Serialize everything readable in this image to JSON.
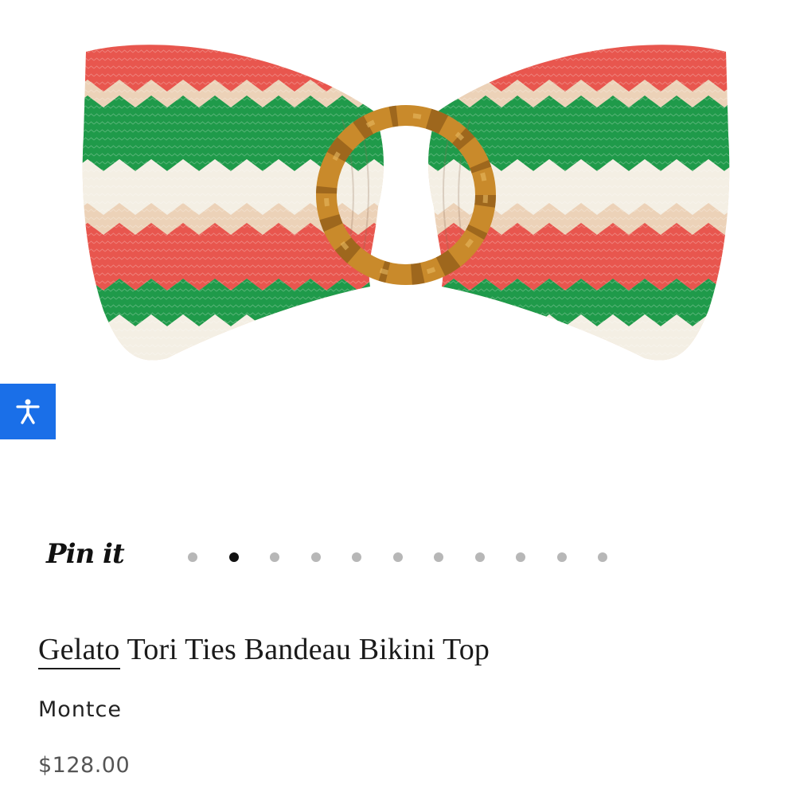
{
  "product": {
    "image_alt": "Gelato Tori Ties Bandeau Bikini Top",
    "title_brand": "Gelato",
    "title_rest": " Tori Ties Bandeau Bikini Top",
    "vendor": "Montce",
    "price": "$128.00"
  },
  "share": {
    "pin_label": "Pin it"
  },
  "carousel": {
    "total": 11,
    "active_index": 1
  },
  "colors": {
    "accessibility_blue": "#1a6fe8",
    "stripe_red": "#e8564e",
    "stripe_green": "#1f9a4a",
    "stripe_beige": "#ecd2b8",
    "stripe_cream": "#f4efe4",
    "ring_tortoise": "#c98a2b"
  },
  "icons": {
    "accessibility": "accessibility-person-icon"
  }
}
